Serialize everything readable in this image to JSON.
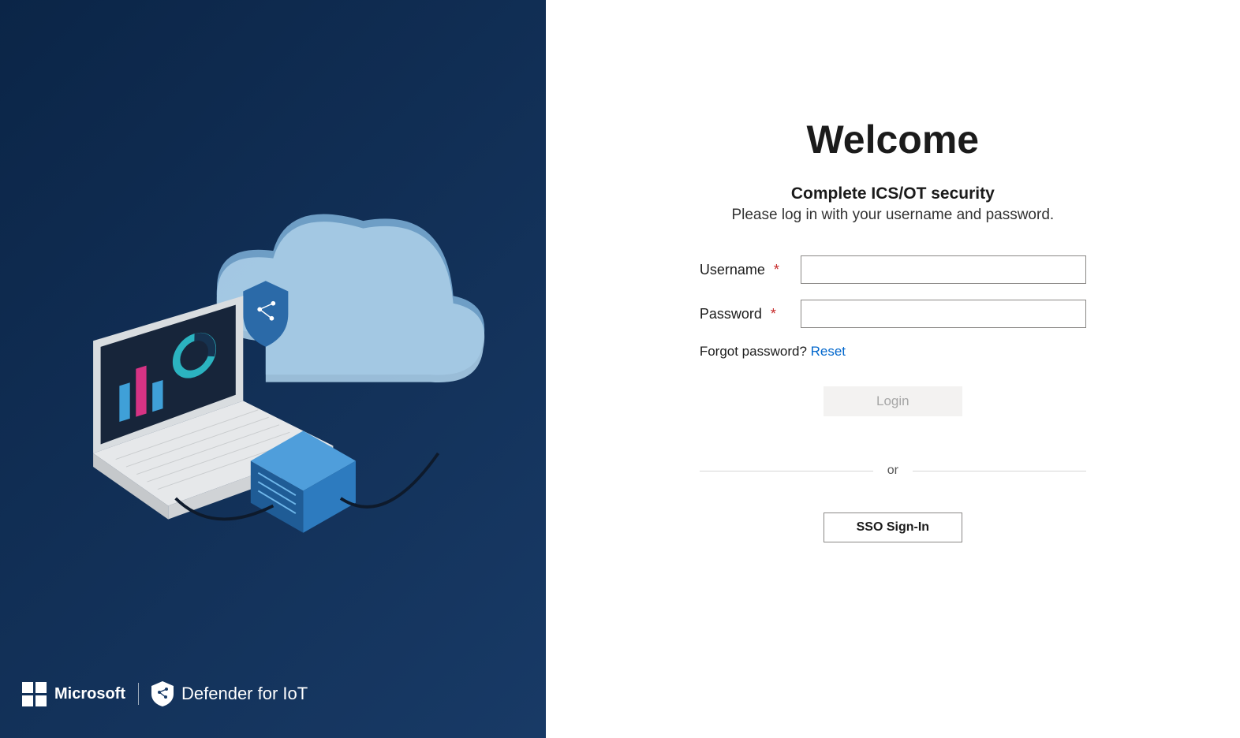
{
  "branding": {
    "company": "Microsoft",
    "product": "Defender for IoT"
  },
  "welcome": {
    "title": "Welcome",
    "subtitle": "Complete ICS/OT security",
    "instruction": "Please log in with your username and password."
  },
  "form": {
    "username_label": "Username",
    "password_label": "Password",
    "required_mark": "*",
    "forgot_prefix": "Forgot password? ",
    "reset_link": "Reset",
    "login_button": "Login",
    "divider": "or",
    "sso_button": "SSO Sign-In"
  }
}
